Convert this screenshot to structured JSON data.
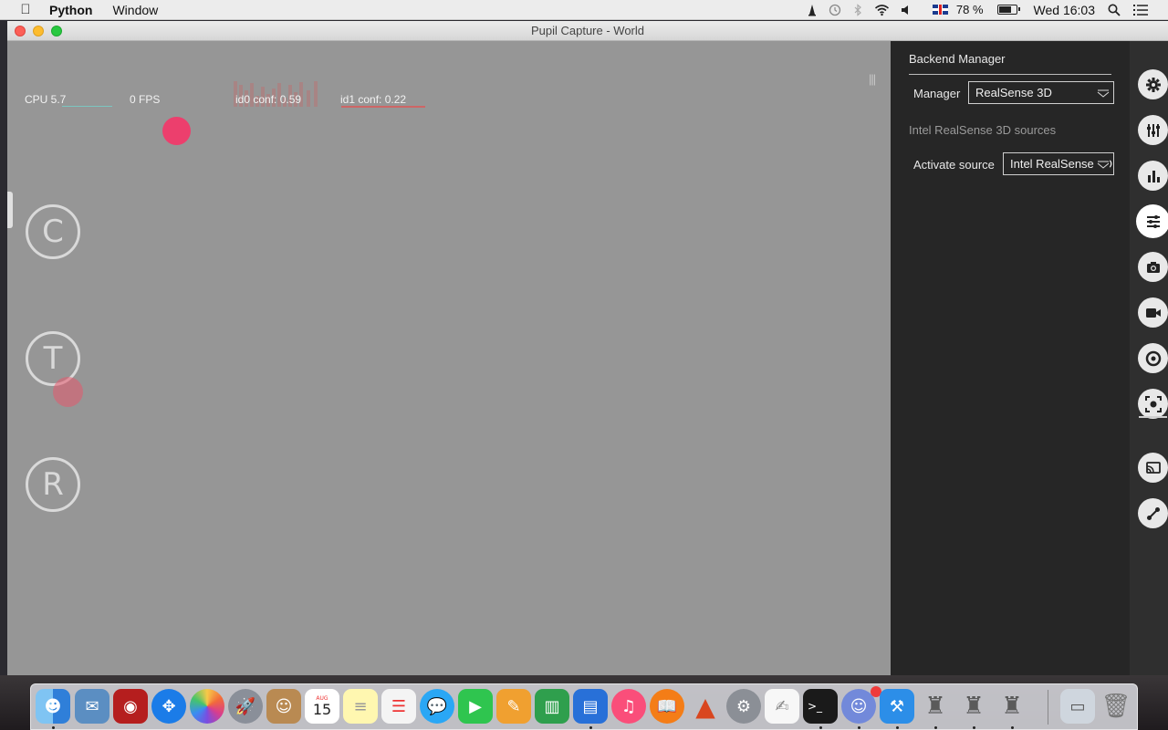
{
  "menubar": {
    "app_name": "Python",
    "menus": [
      "Window"
    ],
    "battery_percent": "78 %",
    "battery_level": 0.78,
    "clock": "Wed 16:03",
    "icons": [
      "apple-icon",
      "vlc-icon",
      "time-machine-icon",
      "bluetooth-icon",
      "wifi-icon",
      "volume-icon",
      "uk-flag-icon",
      "battery-icon",
      "spotlight-icon",
      "notification-center-icon"
    ]
  },
  "window": {
    "title": "Pupil Capture - World"
  },
  "world": {
    "cpu_label": "CPU 5.7",
    "fps_label": "0 FPS",
    "id0_label": "id0 conf: 0.59",
    "id1_label": "id1 conf: 0.22",
    "buttons": {
      "calibrate": "C",
      "test": "T",
      "record": "R"
    },
    "colors": {
      "gaze_dot": "#f03a6a",
      "background": "#969696"
    }
  },
  "panel": {
    "title": "Backend Manager",
    "manager_label": "Manager",
    "manager_value": "RealSense 3D",
    "info_text": "Intel RealSense 3D sources",
    "activate_label": "Activate source",
    "activate_value": "Intel RealSense 3D"
  },
  "iconbar": {
    "icons": [
      "settings-icon",
      "plugin-manager-icon",
      "system-graphs-icon",
      "backend-manager-icon",
      "recorder-icon",
      "video-source-icon",
      "calibration-icon",
      "fixation-detector-icon",
      "remote-icon",
      "network-icon"
    ],
    "active": "backend-manager-icon"
  },
  "dock": {
    "calendar_month": "AUG",
    "calendar_day": "15",
    "icons": [
      "finder",
      "preview",
      "photo-booth",
      "safari",
      "photos",
      "launchpad",
      "contacts",
      "calendar",
      "notes",
      "reminders",
      "messages",
      "facetime",
      "pages-pen",
      "numbers",
      "keynote",
      "itunes",
      "ibooks",
      "matlab",
      "system-preferences",
      "textedit",
      "terminal",
      "discord",
      "xcode",
      "python-launcher-1",
      "python-launcher-2",
      "python-launcher-3",
      "downloads",
      "trash"
    ],
    "discord_badge": true
  }
}
